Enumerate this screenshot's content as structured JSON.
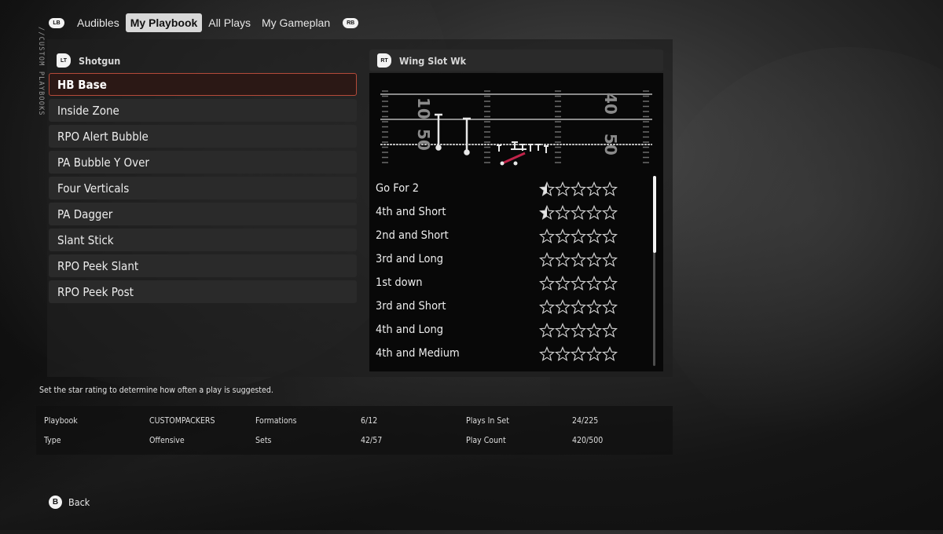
{
  "tabs": {
    "left_bumper": "LB",
    "right_bumper": "RB",
    "items": [
      {
        "label": "Audibles",
        "active": false
      },
      {
        "label": "My Playbook",
        "active": true
      },
      {
        "label": "All Plays",
        "active": false
      },
      {
        "label": "My Gameplan",
        "active": false
      }
    ]
  },
  "side_label": "//CUSTOM PLAYBOOKS",
  "formation": {
    "trigger": "LT",
    "name": "Shotgun"
  },
  "set": {
    "trigger": "RT",
    "name": "Wing Slot Wk"
  },
  "plays": [
    {
      "label": "HB Base",
      "selected": true
    },
    {
      "label": "Inside Zone",
      "selected": false
    },
    {
      "label": "RPO Alert Bubble",
      "selected": false
    },
    {
      "label": "PA Bubble Y Over",
      "selected": false
    },
    {
      "label": "Four Verticals",
      "selected": false
    },
    {
      "label": "PA Dagger",
      "selected": false
    },
    {
      "label": "Slant Stick",
      "selected": false
    },
    {
      "label": "RPO Peek Slant",
      "selected": false
    },
    {
      "label": "RPO Peek Post",
      "selected": false
    }
  ],
  "diagram": {
    "yard_numbers": [
      "10",
      "50",
      "40",
      "50"
    ],
    "route_color": "#c0244a"
  },
  "situations": [
    {
      "label": "Go For 2",
      "rating": 0.5
    },
    {
      "label": "4th and Short",
      "rating": 0.5
    },
    {
      "label": "2nd and Short",
      "rating": 0
    },
    {
      "label": "3rd and Long",
      "rating": 0
    },
    {
      "label": "1st down",
      "rating": 0
    },
    {
      "label": "3rd and Short",
      "rating": 0
    },
    {
      "label": "4th and Long",
      "rating": 0
    },
    {
      "label": "4th and Medium",
      "rating": 0
    }
  ],
  "rating_max": 5,
  "hint": "Set the star rating to determine how often a play is suggested.",
  "stats": {
    "playbook_label": "Playbook",
    "playbook_value": "CUSTOMPACKERS",
    "type_label": "Type",
    "type_value": "Offensive",
    "formations_label": "Formations",
    "formations_value": "6/12",
    "sets_label": "Sets",
    "sets_value": "42/57",
    "plays_in_set_label": "Plays In Set",
    "plays_in_set_value": "24/225",
    "play_count_label": "Play Count",
    "play_count_value": "420/500"
  },
  "back": {
    "button": "B",
    "label": "Back"
  },
  "colors": {
    "selected_border": "#b54a3a",
    "selected_bg": "#2b1815",
    "star_outline": "#d0d0d0"
  }
}
